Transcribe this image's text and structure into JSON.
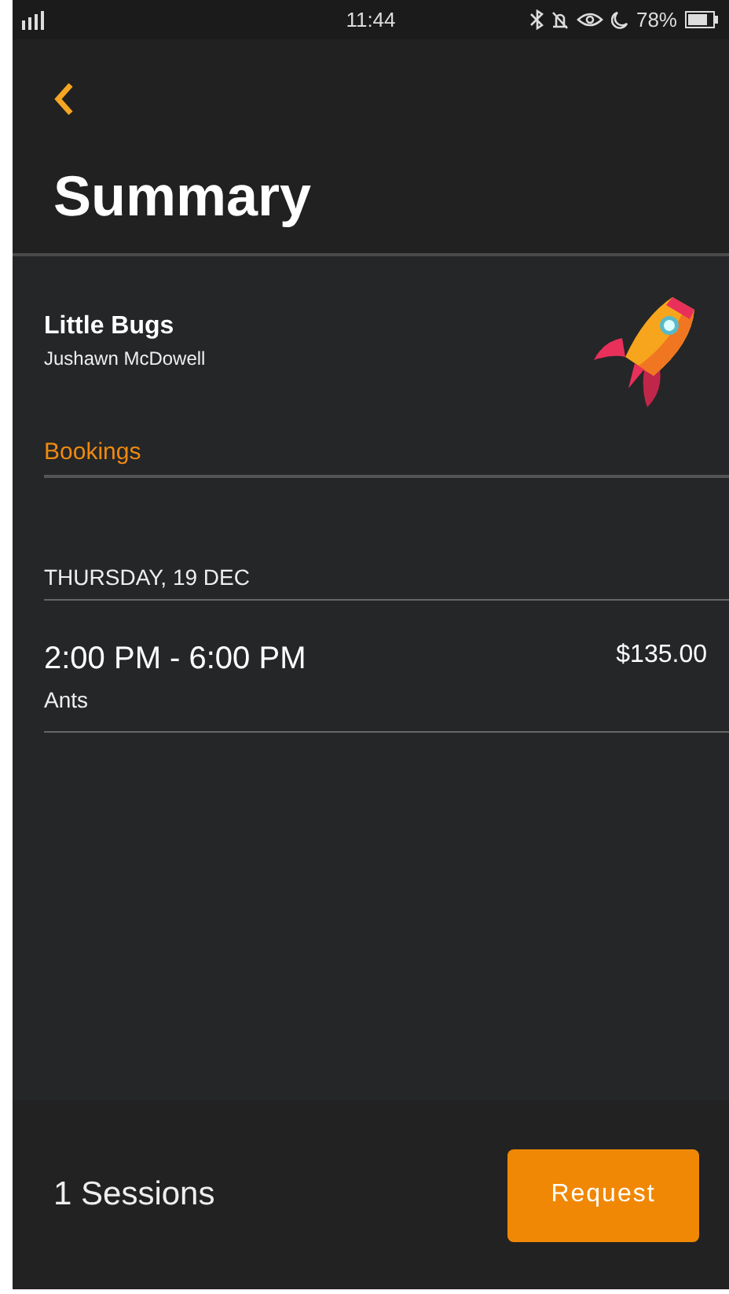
{
  "status_bar": {
    "time": "11:44",
    "battery": "78%"
  },
  "header": {
    "title": "Summary"
  },
  "profile": {
    "name": "Little Bugs",
    "subtitle": "Jushawn McDowell"
  },
  "section": {
    "label": "Bookings"
  },
  "days": [
    {
      "date": "THURSDAY, 19 DEC",
      "bookings": [
        {
          "time": "2:00 PM - 6:00 PM",
          "group": "Ants",
          "price": "$135.00"
        }
      ]
    }
  ],
  "footer": {
    "sessions": "1 Sessions",
    "button": "Request"
  }
}
